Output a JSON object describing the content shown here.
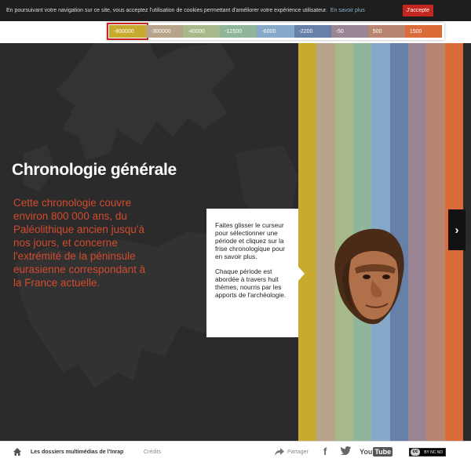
{
  "cookie": {
    "text": "En poursuivant votre navigation sur ce site, vous acceptez l'utilisation de cookies permettant d'améliorer votre expérience utilisateur.",
    "more_link": "En savoir plus",
    "accept_label": "J'accepte"
  },
  "timeline": {
    "segments": [
      {
        "label": "-800000",
        "color": "#c8aa2e",
        "active": true
      },
      {
        "label": "-300000",
        "color": "#b8a48a"
      },
      {
        "label": "-40000",
        "color": "#a7b98a"
      },
      {
        "label": "-12500",
        "color": "#8fb59a"
      },
      {
        "label": "-6000",
        "color": "#86a9c9"
      },
      {
        "label": "-2200",
        "color": "#6680aa"
      },
      {
        "label": "-50",
        "color": "#9a8595"
      },
      {
        "label": "500",
        "color": "#b98570"
      },
      {
        "label": "1500",
        "color": "#dc6b3a"
      }
    ]
  },
  "main": {
    "title": "Chronologie générale",
    "intro": "Cette chronologie couvre environ 800 000 ans, du Paléolithique ancien jusqu'à nos jours, et concerne l'extrémité de la péninsule eurasienne correspondant à la France actuelle.",
    "tooltip": {
      "p1": "Faites glisser le curseur pour sélectionner une période et cliquez sur la frise chronologique pour en savoir plus.",
      "p2": "Chaque période est abordée à travers huit thèmes, nourris par les apports de l'archéologie."
    },
    "next_icon": "›",
    "accent_color": "#d34b2e"
  },
  "footer": {
    "site_label": "Les dossiers multimédias de l'Inrap",
    "credits_label": "Crédits",
    "share_label": "Partager",
    "youtube_you": "You",
    "youtube_tube": "Tube",
    "license_label": "BY NC ND"
  }
}
